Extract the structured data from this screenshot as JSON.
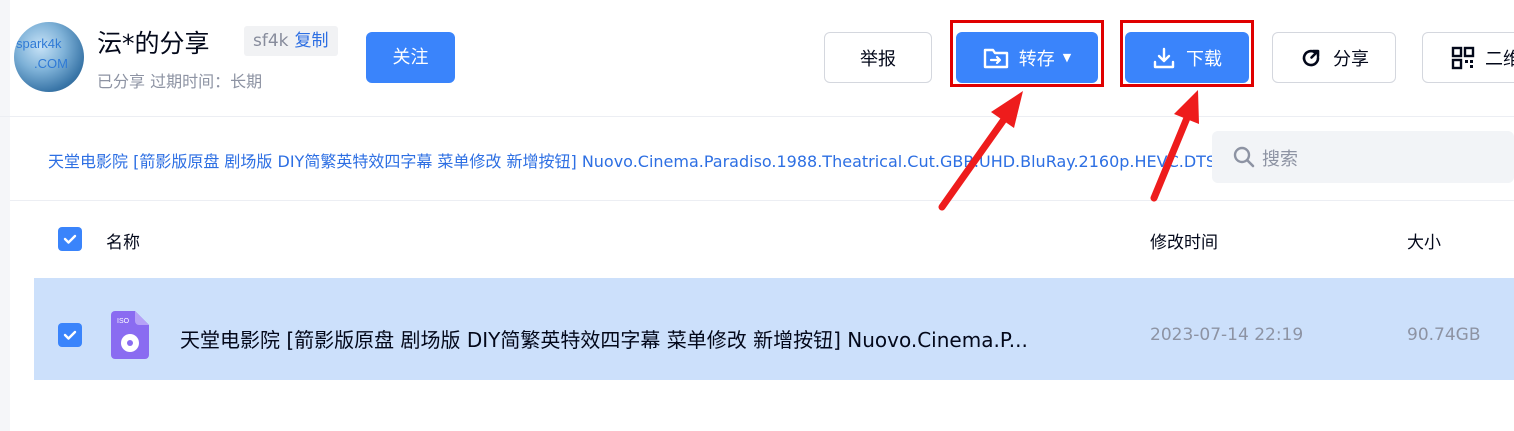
{
  "header": {
    "avatar_text_line1": "spark4k",
    "avatar_text_line2": ".COM",
    "username": "沄*的分享",
    "tag": "sf4k",
    "copy_label": "复制",
    "follow_label": "关注",
    "share_status": "已分享 过期时间：长期",
    "report_label": "举报",
    "save_label": "转存",
    "download_label": "下载",
    "share_label": "分享",
    "qr_label": "二维"
  },
  "breadcrumb": {
    "path": "天堂电影院 [箭影版原盘 剧场版 DIY简繁英特效四字幕 菜单修改 新增按钮] Nuovo.Cinema.Paradiso.1988.Theatrical.Cut.GBR.UHD.BluRay.2160p.HEVC.DTS-HD.MA..."
  },
  "search": {
    "placeholder": "搜索"
  },
  "table": {
    "headers": {
      "name": "名称",
      "modified": "修改时间",
      "size": "大小"
    },
    "rows": [
      {
        "name": "天堂电影院 [箭影版原盘 剧场版 DIY简繁英特效四字幕 菜单修改 新增按钮] Nuovo.Cinema.P...",
        "modified": "2023-07-14 22:19",
        "size": "90.74GB",
        "file_type": "ISO",
        "checked": true
      }
    ]
  },
  "icons": {
    "save": "folder-transfer-icon",
    "download": "download-icon",
    "share": "share-refresh-icon",
    "qr": "qr-code-icon",
    "search": "search-icon",
    "file": "iso-disc-file-icon"
  },
  "colors": {
    "primary": "#3a84fb",
    "link": "#2d6fe3",
    "selected_row": "#cce0fb",
    "highlight_box": "#e00000",
    "annotation_arrow": "#ee1c1c"
  }
}
